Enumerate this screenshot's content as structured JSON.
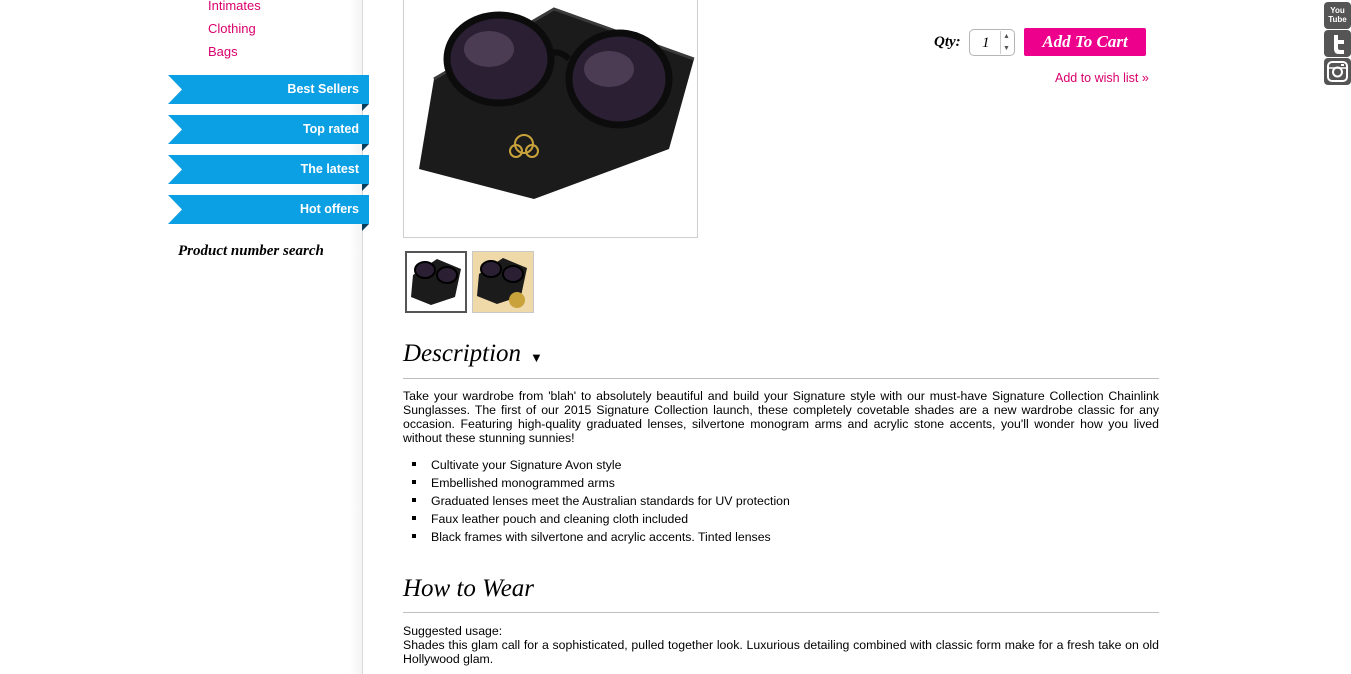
{
  "sidebar": {
    "categories": [
      "Intimates",
      "Clothing",
      "Bags"
    ],
    "ribbons": [
      "Best Sellers",
      "Top rated",
      "The latest",
      "Hot offers"
    ],
    "product_search_label": "Product number search"
  },
  "product": {
    "qty_label": "Qty:",
    "qty_value": "1",
    "add_to_cart": "Add To Cart",
    "wish_list": "Add to wish list »",
    "thumbnails": [
      "sunglasses-on-pouch-white",
      "sunglasses-on-pouch-gold"
    ]
  },
  "description": {
    "title": "Description",
    "caret": "▼",
    "text": "Take your wardrobe from 'blah' to absolutely beautiful and build your Signature style with our must-have Signature Collection Chainlink Sunglasses. The first of our 2015 Signature Collection launch, these completely covetable shades are a new wardrobe classic for any occasion. Featuring high-quality graduated lenses, silvertone monogram arms and acrylic stone accents, you'll wonder how you lived without these stunning sunnies!",
    "bullets": [
      "Cultivate your Signature Avon style",
      "Embellished monogrammed arms",
      "Graduated lenses meet the Australian standards for UV protection",
      "Faux leather pouch and cleaning cloth included",
      "Black frames with silvertone and acrylic accents. Tinted lenses"
    ]
  },
  "how_to_wear": {
    "title": "How to Wear",
    "label": "Suggested usage:",
    "text": "Shades this glam call for a sophisticated, pulled together look. Luxurious detailing combined with classic form make for a fresh take on old Hollywood glam."
  },
  "social": {
    "youtube_label": "You Tube",
    "icons": [
      "youtube-icon",
      "twitter-icon",
      "instagram-icon"
    ]
  },
  "colors": {
    "accent_pink": "#ec008c",
    "link_pink": "#d9006c",
    "ribbon_blue": "#0b9fe4"
  }
}
